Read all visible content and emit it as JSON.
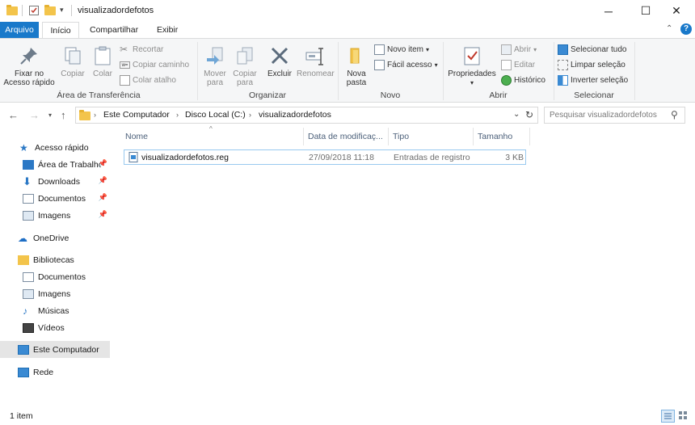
{
  "window": {
    "title": "visualizadordefotos",
    "minimize_glyph": "─",
    "maximize_glyph": "☐",
    "close_glyph": "✕"
  },
  "tabs": {
    "file": "Arquivo",
    "home": "Início",
    "share": "Compartilhar",
    "view": "Exibir"
  },
  "ribbon": {
    "clipboard": {
      "pin_label": "Fixar no\nAcesso rápido",
      "copy_label": "Copiar",
      "paste_label": "Colar",
      "cut_label": "Recortar",
      "copy_path_label": "Copiar caminho",
      "paste_shortcut_label": "Colar atalho",
      "group_label": "Área de Transferência"
    },
    "organize": {
      "move_label": "Mover\npara",
      "copy_to_label": "Copiar\npara",
      "delete_label": "Excluir",
      "rename_label": "Renomear",
      "group_label": "Organizar"
    },
    "new": {
      "new_folder_label": "Nova\npasta",
      "new_item_label": "Novo item",
      "easy_access_label": "Fácil acesso",
      "group_label": "Novo"
    },
    "open": {
      "properties_label": "Propriedades",
      "open_label": "Abrir",
      "edit_label": "Editar",
      "history_label": "Histórico",
      "group_label": "Abrir"
    },
    "select": {
      "select_all_label": "Selecionar tudo",
      "select_none_label": "Limpar seleção",
      "invert_label": "Inverter seleção",
      "group_label": "Selecionar"
    }
  },
  "address": {
    "crumbs": [
      "Este Computador",
      "Disco Local (C:)",
      "visualizadordefotos"
    ],
    "search_placeholder": "Pesquisar visualizadordefotos"
  },
  "navpane": {
    "quick_access": "Acesso rápido",
    "desktop": "Área de Trabalho",
    "downloads": "Downloads",
    "documents": "Documentos",
    "images": "Imagens",
    "onedrive": "OneDrive",
    "libraries": "Bibliotecas",
    "lib_documents": "Documentos",
    "lib_images": "Imagens",
    "lib_music": "Músicas",
    "lib_videos": "Vídeos",
    "this_pc": "Este Computador",
    "network": "Rede"
  },
  "columns": {
    "name": "Nome",
    "date": "Data de modificaç...",
    "type": "Tipo",
    "size": "Tamanho"
  },
  "files": [
    {
      "name": "visualizadordefotos.reg",
      "date": "27/09/2018 11:18",
      "type": "Entradas de registro",
      "size": "3 KB"
    }
  ],
  "status": {
    "item_count": "1 item"
  },
  "colors": {
    "accent": "#1979ca",
    "folder": "#f3c44b"
  }
}
